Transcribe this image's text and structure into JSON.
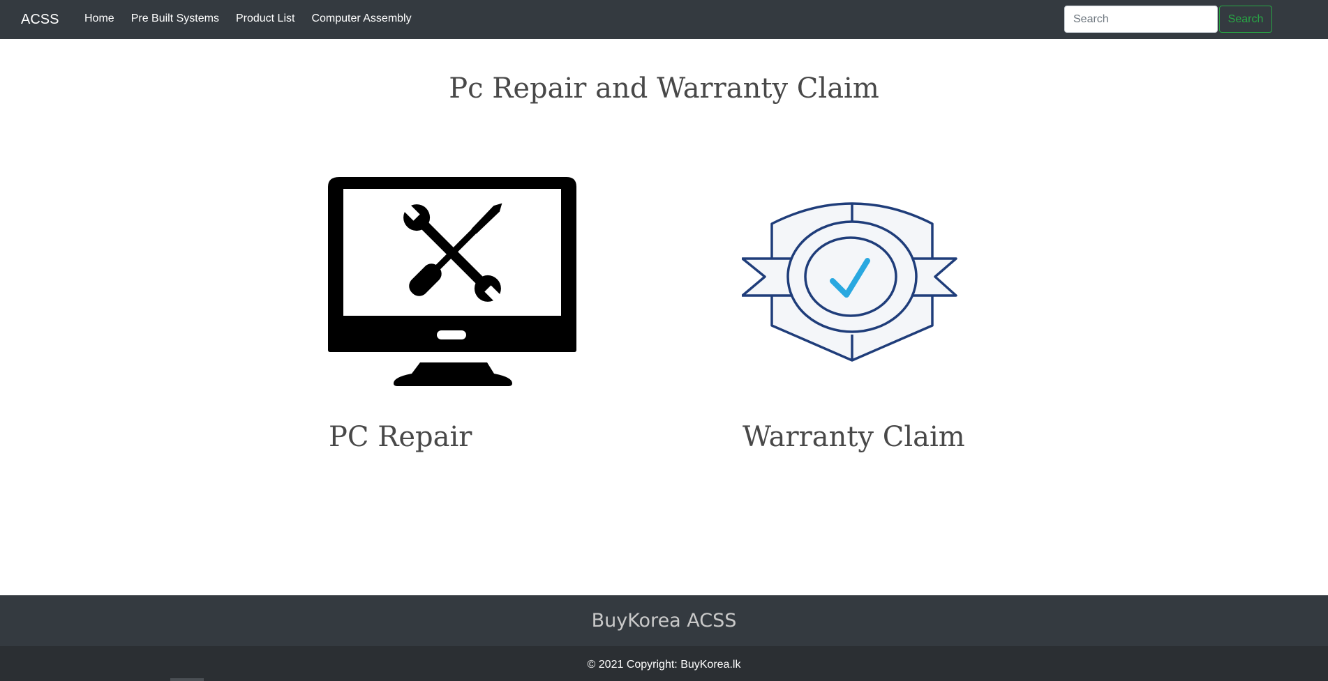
{
  "nav": {
    "brand": "ACSS",
    "links": [
      "Home",
      "Pre Built Systems",
      "Product List",
      "Computer Assembly"
    ],
    "search_placeholder": "Search",
    "search_button": "Search"
  },
  "main": {
    "title": "Pc Repair and Warranty Claim",
    "cards": [
      {
        "label": "PC Repair",
        "icon": "monitor-tools-icon"
      },
      {
        "label": "Warranty Claim",
        "icon": "warranty-badge-icon"
      }
    ]
  },
  "footer": {
    "brand": "BuyKorea ACSS",
    "copyright_prefix": "© 2021 Copyright: ",
    "copyright_link": "BuyKorea.lk"
  },
  "colors": {
    "navbar_bg": "#343a40",
    "footer_bottom_bg": "#2b2f33",
    "search_green": "#28a745",
    "badge_navy": "#1f3d7a",
    "check_blue": "#29a8e0"
  }
}
